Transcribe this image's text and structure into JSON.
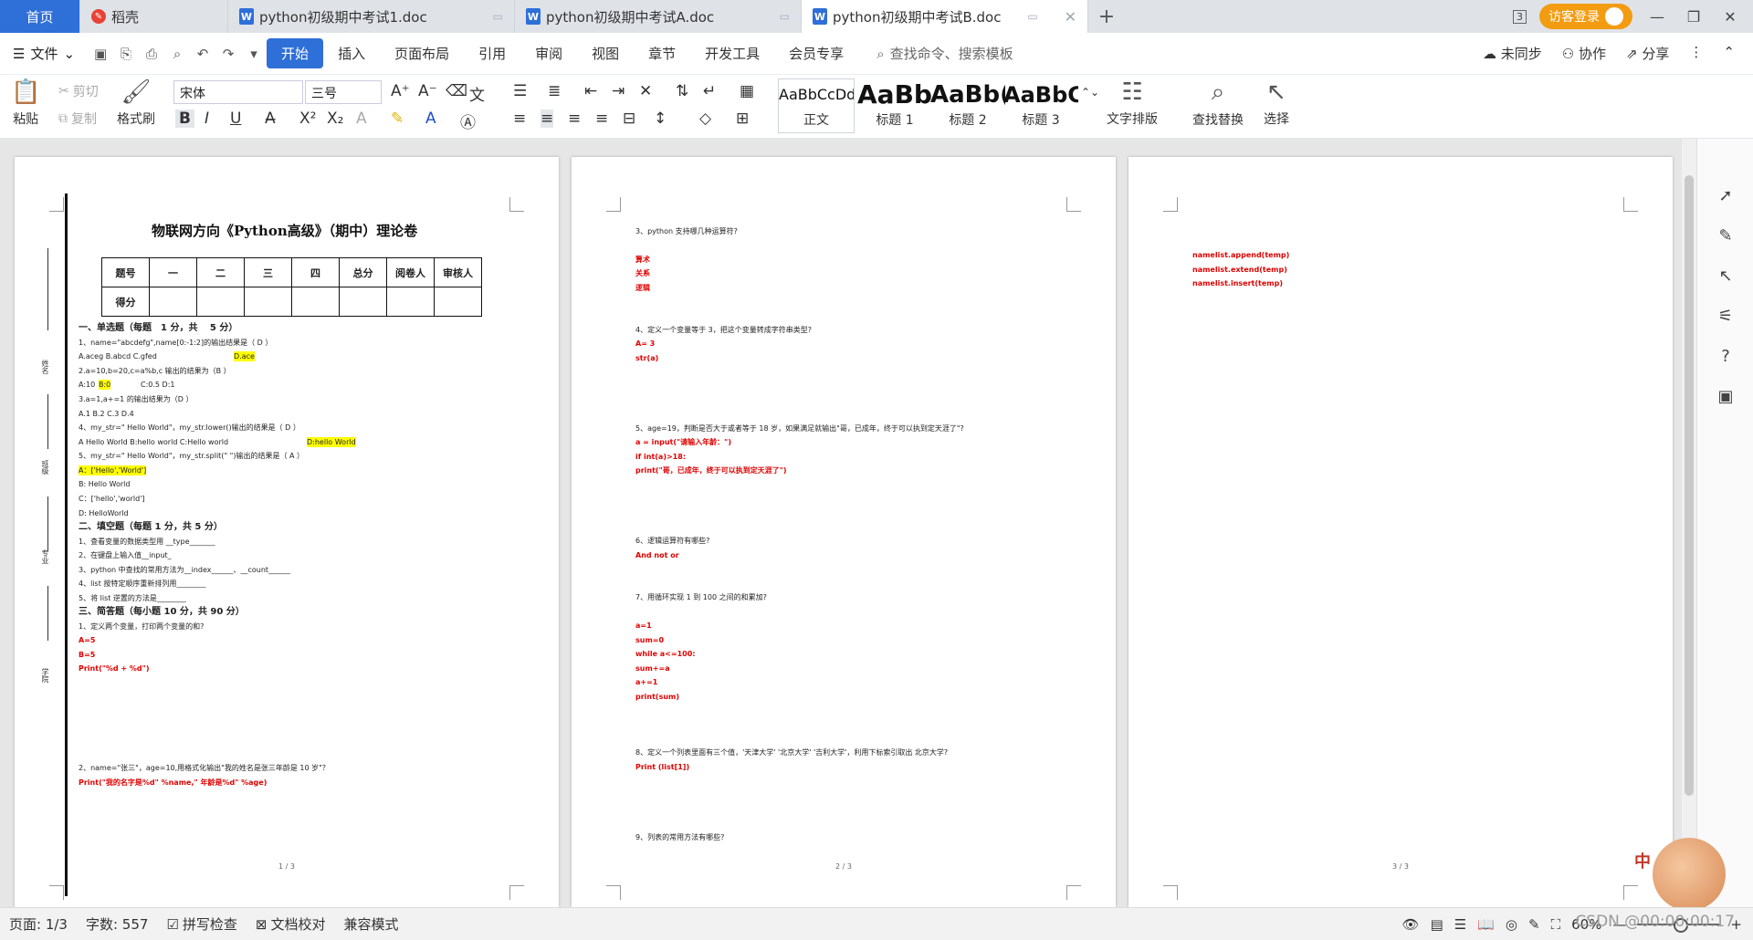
{
  "tabs": {
    "home": "首页",
    "daoke": "稻壳",
    "doc1": "python初级期中考试1.doc",
    "doc2": "python初级期中考试A.doc",
    "doc3": "python初级期中考试B.doc",
    "badge": "3",
    "visitor": "访客登录"
  },
  "menu": {
    "file": "文件",
    "items": [
      "开始",
      "插入",
      "页面布局",
      "引用",
      "审阅",
      "视图",
      "章节",
      "开发工具",
      "会员专享"
    ],
    "search": "查找命令、搜索模板",
    "right": [
      "未同步",
      "协作",
      "分享"
    ]
  },
  "ribbon": {
    "paste": "粘贴",
    "cut": "剪切",
    "copy": "复制",
    "format_painter": "格式刷",
    "font": "宋体",
    "size": "三号",
    "styles": [
      {
        "sample": "AaBbCcDd",
        "label": "正文"
      },
      {
        "sample": "AaBb",
        "label": "标题 1"
      },
      {
        "sample": "AaBb(",
        "label": "标题 2"
      },
      {
        "sample": "AaBbC",
        "label": "标题 3"
      }
    ],
    "text_layout": "文字排版",
    "find_replace": "查找替换",
    "select": "选择"
  },
  "page1": {
    "title": "物联网方向《Python高级》（期中）理论卷",
    "table_row1": [
      "题号",
      "一",
      "二",
      "三",
      "四",
      "总分",
      "阅卷人",
      "审核人"
    ],
    "table_row2": [
      "得分",
      "",
      "",
      "",
      "",
      "",
      "",
      ""
    ],
    "binding": [
      "姓名",
      "班级",
      "专业",
      "学院"
    ],
    "lines": [
      "一、单选题（每题　1 分，共　 5 分）",
      "1、name=\"abcdefg\",name[0:-1:2]的输出结果是（  D  ）",
      "A.aceg          B.abcd          C.gfed",
      "D.ace",
      "2.a=10,b=20,c=a%b,c 输出的结果为（B ）",
      "A:10",
      "B:0",
      "C:0.5        D:1",
      "3.a=1,a+=1 的输出结果为（D  ）",
      "A.1      B.2          C.3         D.4",
      "4、my_str=\" Hello World\"，my_str.lower()输出的结果是（   D  ）",
      "A Hello World    B:hello world       C:Hello world",
      "D:hello World",
      "5、my_str=\" Hello World\"，my_str.split(\" \")输出的结果是（ A  ）",
      "A：['Hello','World']",
      "B: Hello World",
      "C：['hello','world']",
      "D: HelloWorld",
      "二、填空题（每题 1 分，共 5 分）",
      "1、查看变量的数据类型用 __type_______",
      "2、在键盘上输入值__input_",
      "3、python 中查找的常用方法为__index______、__count______",
      "4、list 按特定顺序重新排列用________",
      "5、将 list 逆置的方法是________",
      "三、简答题（每小题 10 分，共 90 分）",
      "1、定义两个变量，打印两个变量的和?",
      "A=5",
      "B=5",
      "Print(\"%d + %d\")",
      "2、name=\"张三\"，age=10,用格式化输出\"我的姓名是张三年龄是 10 岁\"？",
      "Print(\"我的名字是%d\" %name,\" 年龄是%d\" %age)"
    ],
    "num": "1 / 3"
  },
  "page2": {
    "lines": [
      "3、python 支持哪几种运算符?",
      "算术",
      "关系",
      "逻辑",
      "4、定义一个变量等于 3，把这个变量转成字符串类型?",
      " A= 3",
      "str(a)",
      "5、age=19，判断是否大于或者等于 18 岁，如果满足就输出\"哥，已成年，终于可以执到定天涯了\"?",
      "a = input(\"请输入年龄：\")",
      "if int(a)>18:",
      "    print(\"哥，已成年，终于可以执到定天涯了\")",
      "6、逻辑运算符有哪些?",
      "And not or",
      "7、用循环实现 1 到 100 之间的和累加?",
      "a=1",
      "sum=0",
      "while a<=100:",
      "    sum+=a",
      "    a+=1",
      "    print(sum)",
      "8、定义一个列表里面有三个值，'天津大学' '北京大学' '吉利大学'，利用下标索引取出  北京大学?",
      "Print (list[1])",
      "9、列表的常用方法有哪些?"
    ],
    "num": "2 / 3"
  },
  "page3": {
    "lines": [
      "namelist.append(temp)",
      "namelist.extend(temp)",
      "namelist.insert(temp)"
    ],
    "num": "3 / 3"
  },
  "status": {
    "page": "页面: 1/3",
    "words": "字数: 557",
    "spell": "拼写检查",
    "proof": "文档校对",
    "compat": "兼容模式",
    "zoom": "60%",
    "watermark": "CSDN @00:00:00:17",
    "ime": "中"
  }
}
